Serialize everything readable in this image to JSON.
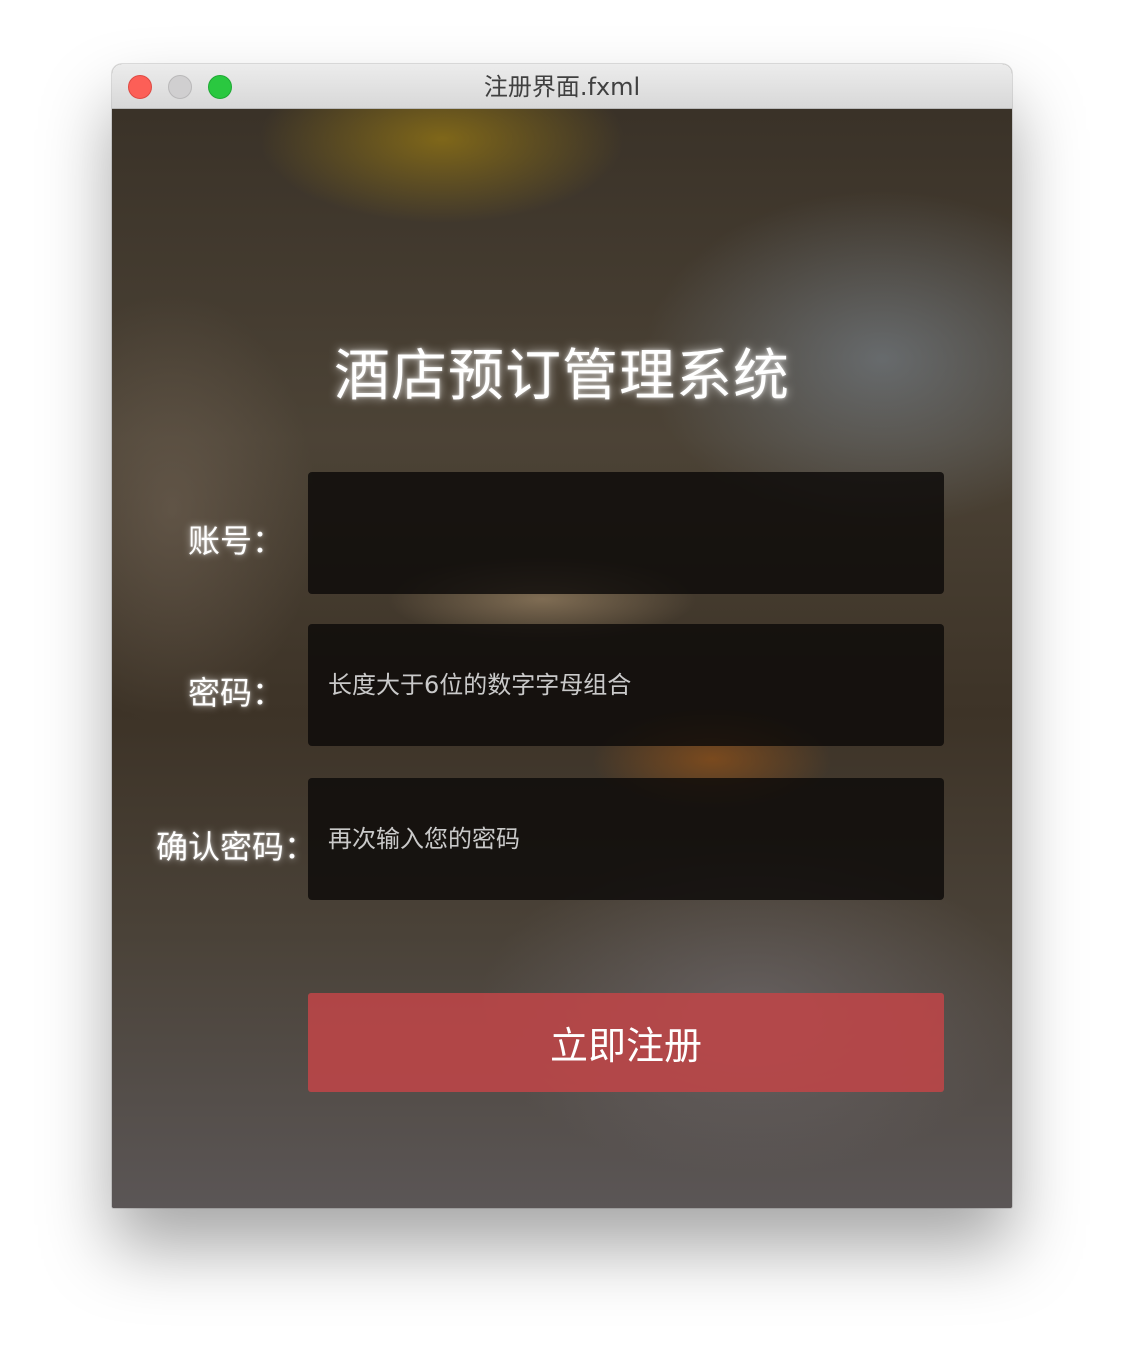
{
  "window": {
    "title": "注册界面.fxml"
  },
  "form": {
    "app_title": "酒店预订管理系统",
    "account": {
      "label": "账号：",
      "value": "",
      "placeholder": ""
    },
    "password": {
      "label": "密码：",
      "value": "",
      "placeholder": "长度大于6位的数字字母组合"
    },
    "confirm_password": {
      "label": "确认密码：",
      "value": "",
      "placeholder": "再次输入您的密码"
    },
    "register_button_label": "立即注册"
  },
  "colors": {
    "accent_button": "#be4648",
    "close_light": "#fc5f57",
    "minimize_light": "#d0cfd0",
    "zoom_light": "#2ac840"
  }
}
